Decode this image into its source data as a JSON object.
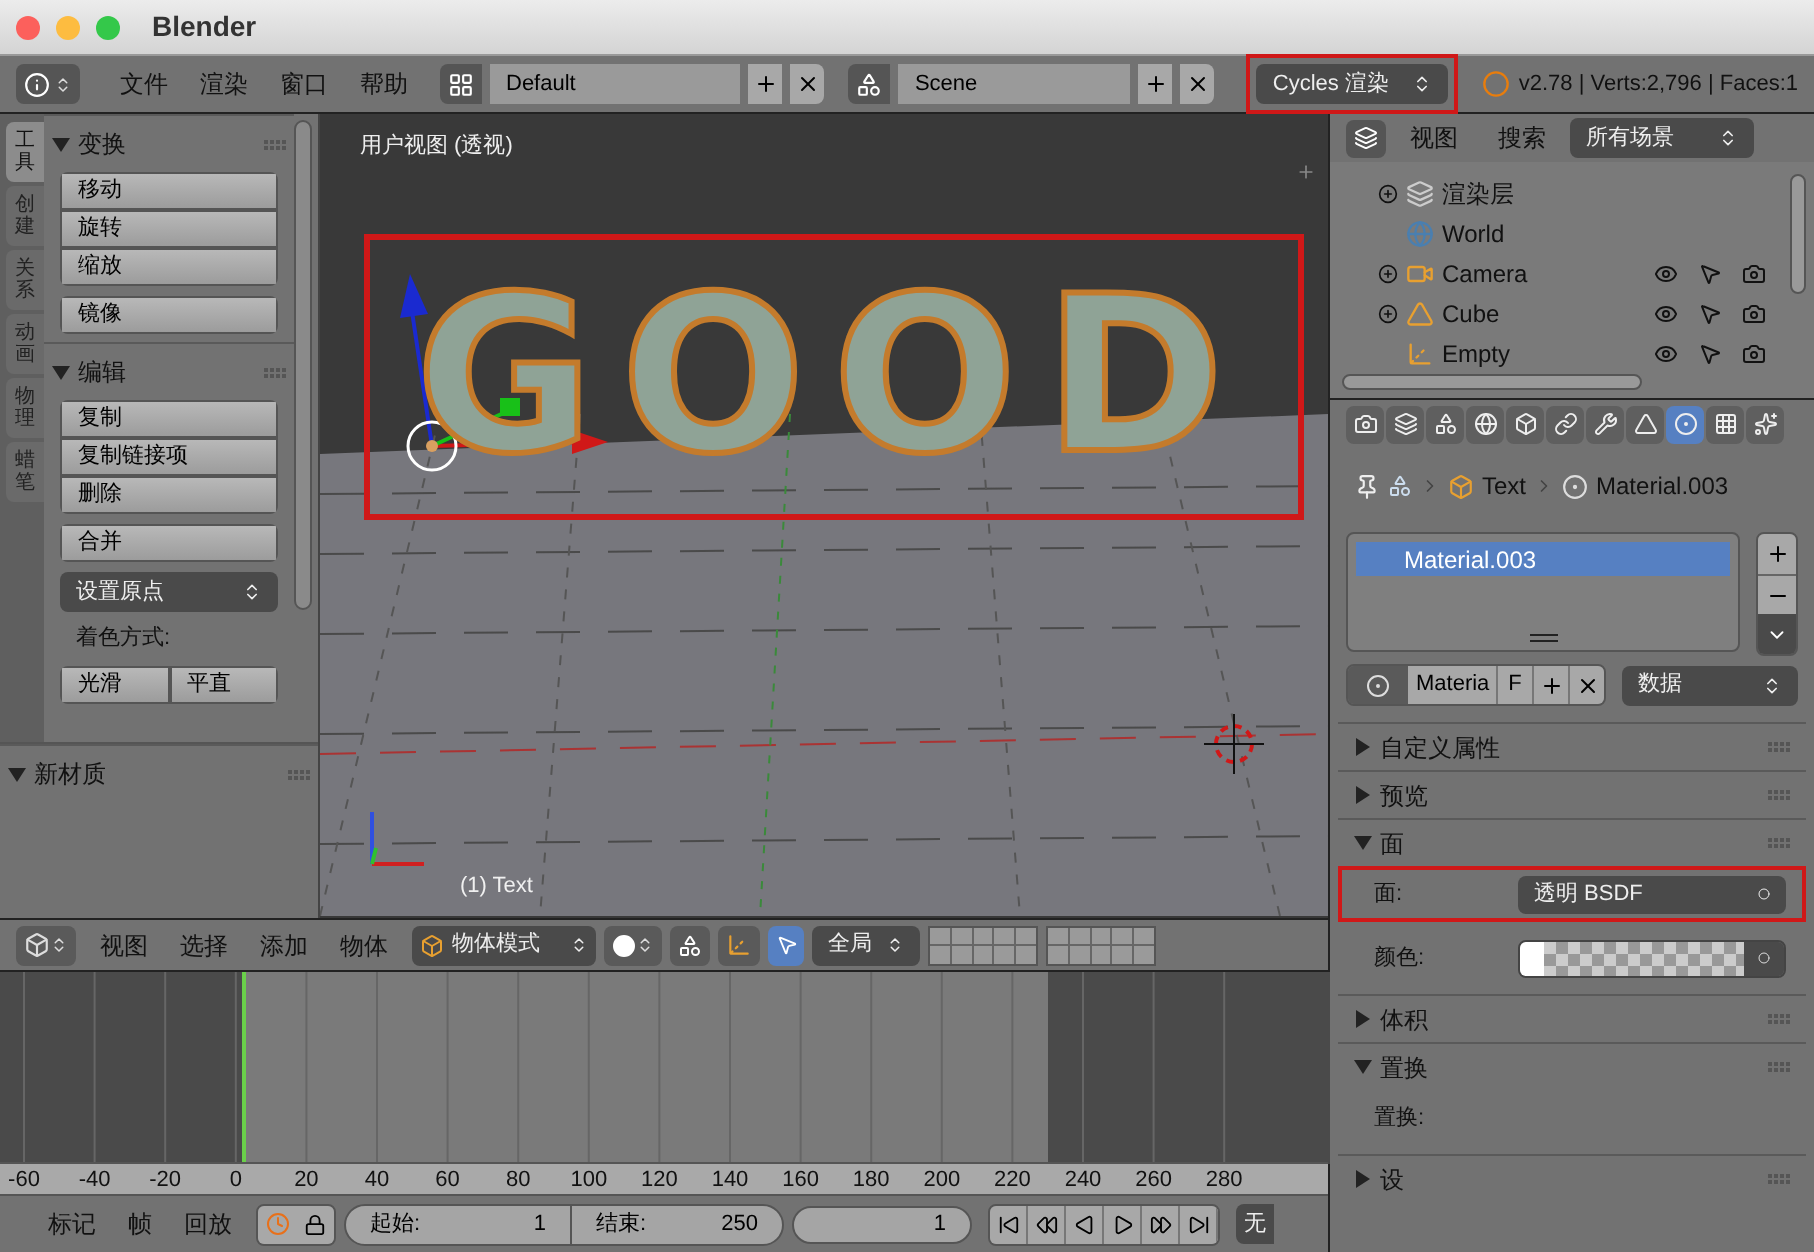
{
  "window": {
    "title": "Blender"
  },
  "info_header": {
    "menus": [
      "文件",
      "渲染",
      "窗口",
      "帮助"
    ],
    "layout": "Default",
    "scene": "Scene",
    "engine": {
      "label": "Cycles 渲染",
      "highlighted": true
    },
    "stats": "v2.78 | Verts:2,796 | Faces:1"
  },
  "tool_shelf": {
    "tabs": [
      {
        "label": "工具",
        "selected": true
      },
      {
        "label": "创建",
        "selected": false
      },
      {
        "label": "关系",
        "selected": false
      },
      {
        "label": "动画",
        "selected": false
      },
      {
        "label": "物理",
        "selected": false
      },
      {
        "label": "蜡笔",
        "selected": false
      }
    ],
    "panels": [
      {
        "title": "变换",
        "expanded": true,
        "items": [
          {
            "kind": "group",
            "labels": [
              "移动",
              "旋转",
              "缩放"
            ]
          },
          {
            "kind": "group",
            "labels": [
              "镜像"
            ]
          }
        ]
      },
      {
        "title": "编辑",
        "expanded": true,
        "items": [
          {
            "kind": "group",
            "labels": [
              "复制",
              "复制链接项",
              "删除"
            ]
          },
          {
            "kind": "group",
            "labels": [
              "合并"
            ]
          },
          {
            "kind": "dropdown",
            "labels": [
              "设置原点"
            ]
          },
          {
            "kind": "label",
            "labels": [
              "着色方式:"
            ]
          },
          {
            "kind": "row",
            "labels": [
              "光滑",
              "平直"
            ]
          }
        ]
      },
      {
        "title": "新材质",
        "expanded": true
      }
    ]
  },
  "viewport": {
    "title": "用户视图 (透视)",
    "object_text": "GOOD",
    "object_highlighted": true,
    "status": "(1) Text"
  },
  "view3d_header": {
    "menus": [
      "视图",
      "选择",
      "添加",
      "物体"
    ],
    "mode": "物体模式",
    "orientation": "全局"
  },
  "timeline": {
    "ruler": [
      "-60",
      "-40",
      "-20",
      "0",
      "20",
      "40",
      "60",
      "80",
      "100",
      "120",
      "140",
      "160",
      "180",
      "200",
      "220",
      "240",
      "260",
      "280"
    ],
    "menus": [
      "标记",
      "帧",
      "回放"
    ],
    "start_label": "起始:",
    "start": "1",
    "end_label": "结束:",
    "end": "250",
    "current": "1",
    "sync": "无"
  },
  "outliner": {
    "menus": [
      "视图",
      "搜索"
    ],
    "filter": "所有场景",
    "rows": [
      {
        "kind": "render_layer",
        "name": "渲染层",
        "expandable": true,
        "toggles": false
      },
      {
        "kind": "world",
        "name": "World",
        "expandable": false,
        "toggles": false
      },
      {
        "kind": "camera",
        "name": "Camera",
        "expandable": true,
        "toggles": true
      },
      {
        "kind": "mesh",
        "name": "Cube",
        "expandable": true,
        "toggles": true
      },
      {
        "kind": "empty",
        "name": "Empty",
        "expandable": false,
        "toggles": true
      }
    ]
  },
  "properties": {
    "tabs": [
      {
        "kind": "render",
        "selected": false
      },
      {
        "kind": "layers",
        "selected": false
      },
      {
        "kind": "scene",
        "selected": false
      },
      {
        "kind": "world",
        "selected": false
      },
      {
        "kind": "object",
        "selected": false
      },
      {
        "kind": "constraints",
        "selected": false
      },
      {
        "kind": "modifiers",
        "selected": false
      },
      {
        "kind": "data",
        "selected": false
      },
      {
        "kind": "material",
        "selected": true
      },
      {
        "kind": "texture",
        "selected": false
      },
      {
        "kind": "particles",
        "selected": false
      }
    ],
    "breadcrumb": [
      "Text",
      "Material.003"
    ],
    "slots": [
      {
        "name": "Material.003",
        "selected": true
      }
    ],
    "datablock": {
      "name": "Materia",
      "users": "F",
      "link": "数据"
    },
    "panels": [
      {
        "title": "自定义属性",
        "expanded": false
      },
      {
        "title": "预览",
        "expanded": false
      },
      {
        "title": "面",
        "expanded": true,
        "fields": [
          {
            "kind": "dropdown",
            "label": "面:",
            "value": "透明 BSDF",
            "highlighted": true
          },
          {
            "kind": "color",
            "label": "颜色:",
            "highlighted": false
          }
        ]
      },
      {
        "title": "体积",
        "expanded": false
      },
      {
        "title": "置换",
        "expanded": true,
        "fields": [
          {
            "kind": "empty",
            "label": "置换:",
            "highlighted": false
          }
        ]
      },
      {
        "title": "设",
        "expanded": false
      }
    ]
  }
}
